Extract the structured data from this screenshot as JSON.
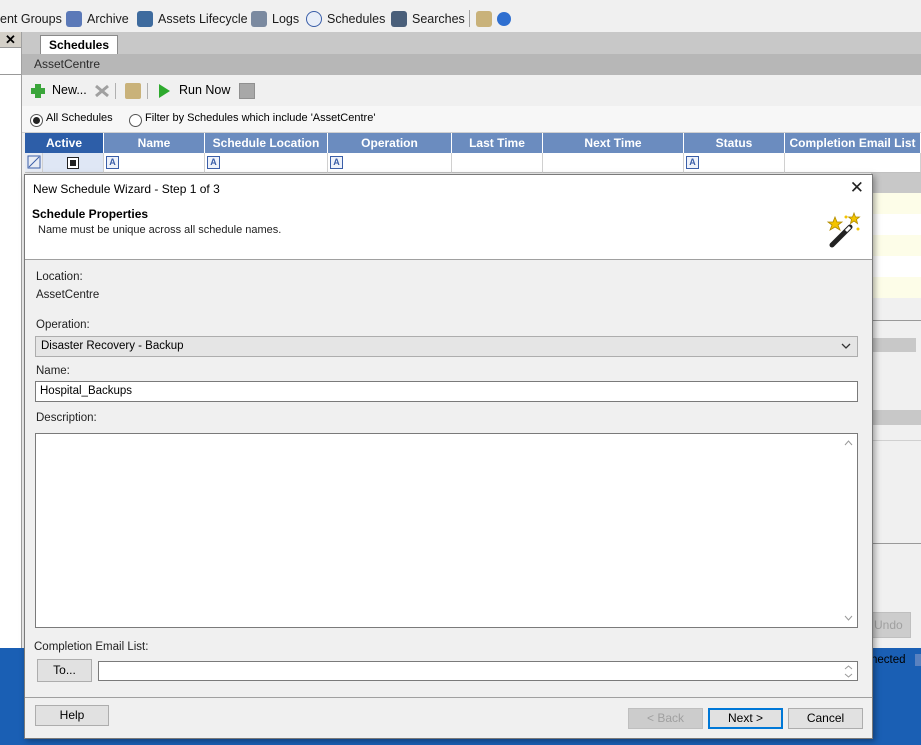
{
  "toolbar": {
    "items": [
      {
        "label": "ent Groups"
      },
      {
        "label": "Archive",
        "icon": "archive-icon"
      },
      {
        "label": "Assets Lifecycle",
        "icon": "lifecycle-icon"
      },
      {
        "label": "Logs",
        "icon": "logs-icon"
      },
      {
        "label": "Schedules",
        "icon": "clock-icon"
      },
      {
        "label": "Searches",
        "icon": "binoculars-icon"
      }
    ]
  },
  "left_panel": {
    "close_glyph": "✕"
  },
  "tabs": {
    "active": "Schedules"
  },
  "breadcrumb": "AssetCentre",
  "actions": {
    "new_label": "New...",
    "run_now_label": "Run Now"
  },
  "filter": {
    "all_label": "All Schedules",
    "filter_label": "Filter by Schedules which include 'AssetCentre'",
    "selected": "all"
  },
  "grid": {
    "columns": [
      "Active",
      "Name",
      "Schedule Location",
      "Operation",
      "Last Time",
      "Next Time",
      "Status",
      "Completion Email List"
    ]
  },
  "background": {
    "undo_label": "Undo",
    "status_text": "nected"
  },
  "dialog": {
    "title": "New Schedule Wizard - Step 1 of 3",
    "heading": "Schedule Properties",
    "subheading": "Name must be unique across all schedule names.",
    "location_label": "Location:",
    "location_value": "AssetCentre",
    "operation_label": "Operation:",
    "operation_value": "Disaster Recovery - Backup",
    "name_label": "Name:",
    "name_value": "Hospital_Backups",
    "description_label": "Description:",
    "description_value": "",
    "email_label": "Completion Email List:",
    "to_button": "To...",
    "email_value": "",
    "help_button": "Help",
    "back_button": "< Back",
    "next_button": "Next >",
    "cancel_button": "Cancel"
  },
  "colors": {
    "grid_header": "#6b8cbf",
    "grid_header_active": "#2d5ea8",
    "desktop": "#1a5fb4",
    "default_button_border": "#0078d7"
  }
}
